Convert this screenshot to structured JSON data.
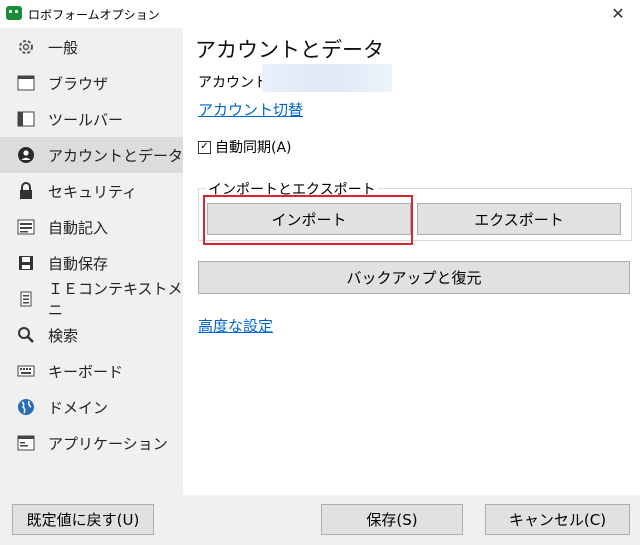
{
  "window": {
    "title": "ロボフォームオプション",
    "close_glyph": "✕"
  },
  "sidebar": {
    "items": [
      {
        "label": "一般",
        "icon": "gear-icon"
      },
      {
        "label": "ブラウザ",
        "icon": "browser-window-icon"
      },
      {
        "label": "ツールバー",
        "icon": "toolbar-icon"
      },
      {
        "label": "アカウントとデータ",
        "icon": "account-icon",
        "active": true
      },
      {
        "label": "セキュリティ",
        "icon": "lock-icon"
      },
      {
        "label": "自動記入",
        "icon": "autofill-icon"
      },
      {
        "label": "自動保存",
        "icon": "save-icon"
      },
      {
        "label": "ＩＥコンテキストメニ",
        "icon": "context-menu-icon"
      },
      {
        "label": "検索",
        "icon": "search-icon"
      },
      {
        "label": "キーボード",
        "icon": "keyboard-icon"
      },
      {
        "label": "ドメイン",
        "icon": "globe-icon"
      },
      {
        "label": "アプリケーション",
        "icon": "application-icon"
      }
    ]
  },
  "main": {
    "title": "アカウントとデータ",
    "account_label": "アカウント:",
    "switch_account_link": "アカウント切替",
    "auto_sync_label": "自動同期(A)",
    "auto_sync_checked": true,
    "import_export_group": "インポートとエクスポート",
    "import_button": "インポート",
    "export_button": "エクスポート",
    "backup_restore_button": "バックアップと復元",
    "advanced_settings_link": "高度な設定"
  },
  "footer": {
    "reset_button": "既定値に戻す(U)",
    "save_button": "保存(S)",
    "cancel_button": "キャンセル(C)"
  },
  "colors": {
    "sidebar_bg": "#f0f0f0",
    "active_bg": "#dcdcdc",
    "link": "#0066cc",
    "highlight": "#d9262c"
  }
}
